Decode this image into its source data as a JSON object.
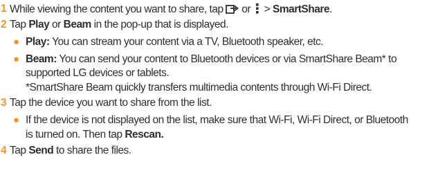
{
  "steps": [
    {
      "number": "1",
      "text_before": "While viewing the content you want to share, tap",
      "text_or": "or",
      "text_sep": ">",
      "bold_target": "SmartShare",
      "end": ".",
      "icons": [
        "share-icon",
        "menu-icon"
      ]
    },
    {
      "number": "2",
      "text_a": "Tap",
      "bold_play": "Play",
      "text_b": "or",
      "bold_beam": "Beam",
      "text_c": "in the pop-up that is displayed.",
      "bullets": [
        {
          "bold": "Play:",
          "text": "You can stream your content via a TV, Bluetooth speaker, etc."
        },
        {
          "bold": "Beam:",
          "text": "You can send your content to Bluetooth devices or via SmartShare Beam* to",
          "continuation": "supported LG devices or tablets.",
          "note": "*SmartShare Beam quickly transfers multimedia contents through Wi-Fi Direct."
        }
      ]
    },
    {
      "number": "3",
      "text": "Tap the device you want to share from the list.",
      "bullets": [
        {
          "text": "If the device is not displayed on the list, make sure that Wi-Fi, Wi-Fi Direct, or Bluetooth",
          "continuation_text": "is turned on. Then tap",
          "continuation_bold": "Rescan."
        }
      ]
    },
    {
      "number": "4",
      "text_a": "Tap",
      "bold": "Send",
      "text_b": "to share the files."
    }
  ],
  "colors": {
    "accent": "#f7941d",
    "text": "#2e2e2e"
  }
}
